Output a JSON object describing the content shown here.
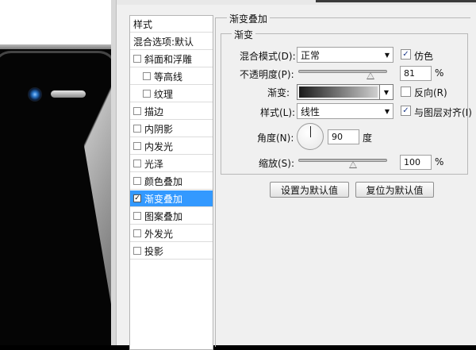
{
  "style_list": {
    "header": "样式",
    "blend_options": "混合选项:默认",
    "items": [
      {
        "label": "斜面和浮雕",
        "checked": false,
        "sub": false
      },
      {
        "label": "等高线",
        "checked": false,
        "sub": true
      },
      {
        "label": "纹理",
        "checked": false,
        "sub": true
      },
      {
        "label": "描边",
        "checked": false,
        "sub": false
      },
      {
        "label": "内阴影",
        "checked": false,
        "sub": false
      },
      {
        "label": "内发光",
        "checked": false,
        "sub": false
      },
      {
        "label": "光泽",
        "checked": false,
        "sub": false
      },
      {
        "label": "颜色叠加",
        "checked": false,
        "sub": false
      },
      {
        "label": "渐变叠加",
        "checked": true,
        "sub": false,
        "selected": true
      },
      {
        "label": "图案叠加",
        "checked": false,
        "sub": false
      },
      {
        "label": "外发光",
        "checked": false,
        "sub": false
      },
      {
        "label": "投影",
        "checked": false,
        "sub": false
      }
    ]
  },
  "panel": {
    "title": "渐变叠加",
    "group_title": "渐变",
    "blend_mode_label": "混合模式(D):",
    "blend_mode_value": "正常",
    "dither_label": "仿色",
    "dither_checked": true,
    "opacity_label": "不透明度(P):",
    "opacity_value": "81",
    "opacity_unit": "%",
    "gradient_label": "渐变:",
    "reverse_label": "反向(R)",
    "reverse_checked": false,
    "style_label": "样式(L):",
    "style_value": "线性",
    "align_label": "与图层对齐(I)",
    "align_checked": true,
    "angle_label": "角度(N):",
    "angle_value": "90",
    "angle_unit": "度",
    "scale_label": "缩放(S):",
    "scale_value": "100",
    "scale_unit": "%",
    "set_default_button": "设置为默认值",
    "reset_default_button": "复位为默认值"
  }
}
